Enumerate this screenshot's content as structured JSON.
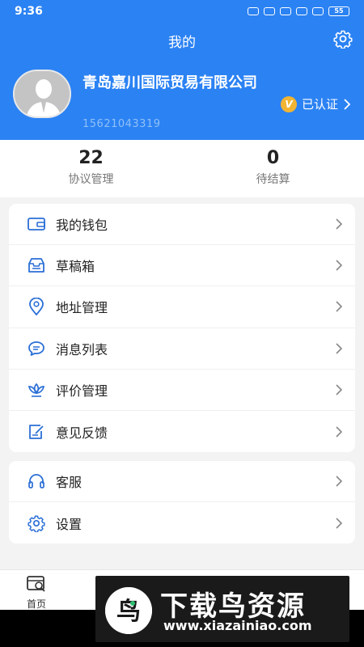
{
  "status_bar": {
    "time": "9:36",
    "battery": "55"
  },
  "header": {
    "title": "我的"
  },
  "profile": {
    "company_name": "青岛嘉川国际贸易有限公司",
    "phone": "15621043319",
    "verified_label": "已认证",
    "verified_badge": "V"
  },
  "stats": [
    {
      "value": "22",
      "label": "协议管理"
    },
    {
      "value": "0",
      "label": "待结算"
    }
  ],
  "menu_group_1": [
    {
      "label": "我的钱包",
      "icon": "wallet-icon"
    },
    {
      "label": "草稿箱",
      "icon": "inbox-icon"
    },
    {
      "label": "地址管理",
      "icon": "location-pin-icon"
    },
    {
      "label": "消息列表",
      "icon": "chat-bubble-icon"
    },
    {
      "label": "评价管理",
      "icon": "lotus-icon"
    },
    {
      "label": "意见反馈",
      "icon": "edit-note-icon"
    }
  ],
  "menu_group_2": [
    {
      "label": "客服",
      "icon": "headset-icon"
    },
    {
      "label": "设置",
      "icon": "gear-icon"
    }
  ],
  "tabbar": {
    "home_label": "首页"
  },
  "watermark": {
    "title": "下载鸟资源",
    "url": "www.xiazainiao.com",
    "logo_glyph": "鸟"
  },
  "colors": {
    "brand_blue": "#2b82f3",
    "badge_gold": "#f1b533",
    "icon_blue": "#2b6fd6"
  }
}
